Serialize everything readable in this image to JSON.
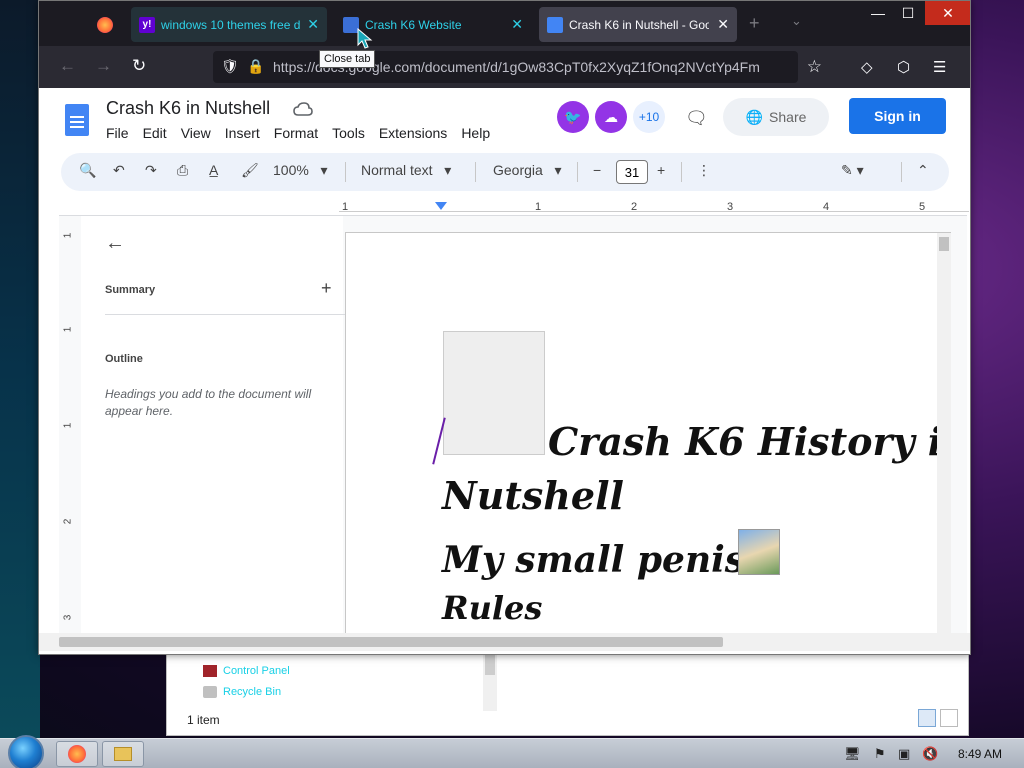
{
  "browser": {
    "tabs": [
      {
        "label": "windows 10 themes free d...",
        "favicon": "yahoo-icon",
        "favicon_text": "y!"
      },
      {
        "label": "Crash K6 Website",
        "favicon": "site-icon"
      },
      {
        "label": "Crash K6 in Nutshell - Goog",
        "favicon": "docs-icon",
        "active": true
      }
    ],
    "tooltip": "Close tab",
    "url": "https://docs.google.com/document/d/1gOw83CpT0fx2XyqZ1fOnq2NVctYp4Fm",
    "icons": {
      "new_tab": "+",
      "tab_list": "⌄",
      "minimize": "—",
      "maximize": "☐",
      "close": "✕",
      "back": "←",
      "forward": "→",
      "reload": "↻",
      "shield": "🛡",
      "lock": "🔒",
      "star": "☆",
      "pocket": "◇",
      "extensions": "⬡",
      "menu": "☰"
    }
  },
  "docs": {
    "title": "Crash K6 in Nutshell",
    "menu": [
      "File",
      "Edit",
      "View",
      "Insert",
      "Format",
      "Tools",
      "Extensions",
      "Help"
    ],
    "avatars": {
      "more": "+10"
    },
    "share_label": "Share",
    "signin_label": "Sign in",
    "toolbar": {
      "zoom": "100%",
      "style": "Normal text",
      "font": "Georgia",
      "font_size": "31",
      "minus": "−",
      "plus": "+"
    },
    "ruler_numbers": [
      "1",
      "1",
      "1",
      "2",
      "3",
      "4",
      "5"
    ],
    "vruler_numbers": [
      "1",
      "1",
      "1",
      "2",
      "3"
    ],
    "outline": {
      "summary_label": "Summary",
      "outline_label": "Outline",
      "hint": "Headings you add to the document will appear here."
    },
    "content": {
      "line1": "Crash K6 History in",
      "line2": "Nutshell",
      "line3": "My small penis",
      "line4": "Rules"
    }
  },
  "explorer": {
    "items": [
      "Control Panel",
      "Recycle Bin"
    ],
    "status": "1 item"
  },
  "taskbar": {
    "clock": "8:49 AM"
  }
}
